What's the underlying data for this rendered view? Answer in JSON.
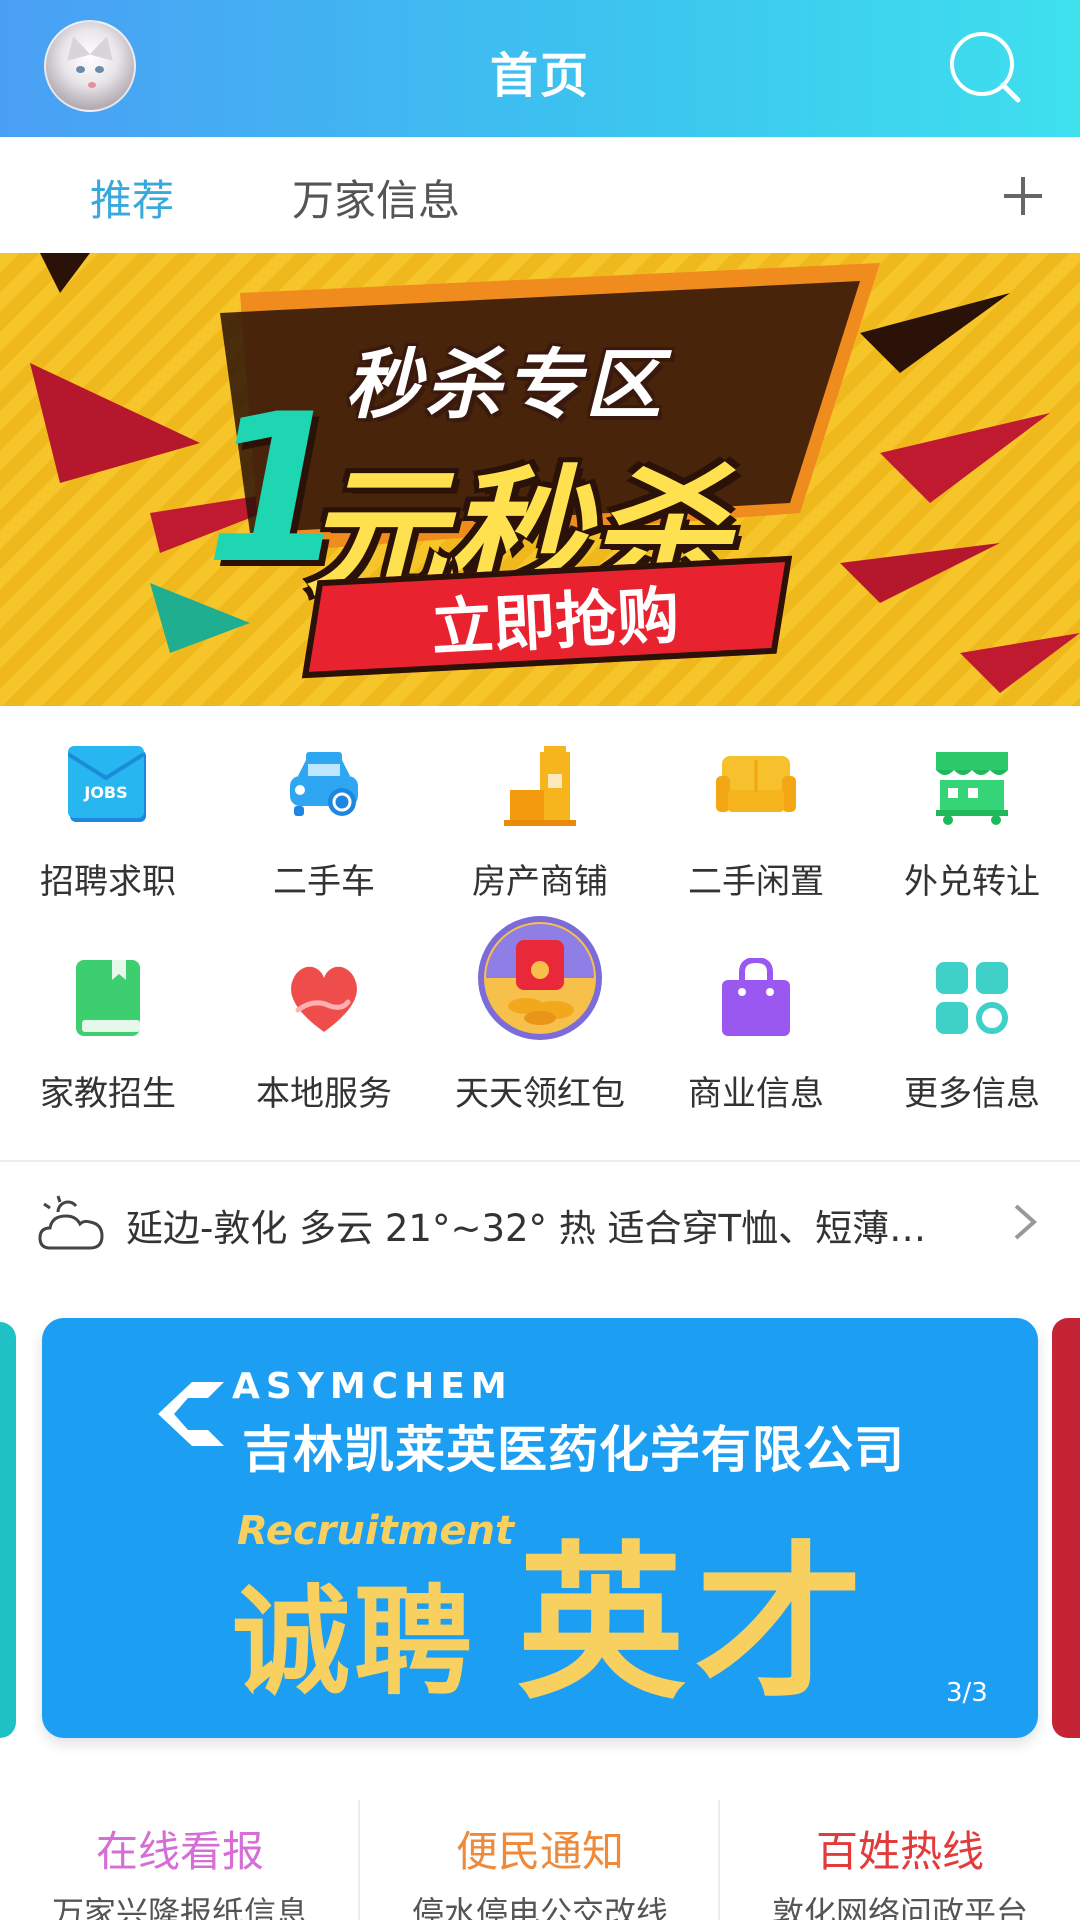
{
  "header": {
    "title": "首页"
  },
  "tabs": [
    {
      "label": "推荐",
      "active": true
    },
    {
      "label": "万家信息",
      "active": false
    }
  ],
  "banner": {
    "headline": "秒杀专区",
    "number": "1",
    "main": "元秒杀",
    "cta": "立即抢购",
    "dots": [
      {
        "active": false
      },
      {
        "active": true
      }
    ]
  },
  "categories": [
    {
      "label": "招聘求职",
      "icon": "jobs-envelope-icon"
    },
    {
      "label": "二手车",
      "icon": "car-icon"
    },
    {
      "label": "房产商铺",
      "icon": "building-icon"
    },
    {
      "label": "二手闲置",
      "icon": "sofa-icon"
    },
    {
      "label": "外兑转让",
      "icon": "storefront-icon"
    },
    {
      "label": "家教招生",
      "icon": "book-icon"
    },
    {
      "label": "本地服务",
      "icon": "heart-hand-icon"
    },
    {
      "label": "天天领红包",
      "icon": "red-envelope-icon"
    },
    {
      "label": "商业信息",
      "icon": "shopping-bag-icon"
    },
    {
      "label": "更多信息",
      "icon": "more-grid-icon"
    }
  ],
  "weather": {
    "text": "延边-敦化 多云 21°~32° 热 适合穿T恤、短薄…",
    "icon": "cloudy-sun-icon"
  },
  "ad": {
    "brand": "ASYMCHEM",
    "company": "吉林凯莱英医药化学有限公司",
    "recruit": "Recruitment",
    "slogan_a": "诚聘",
    "slogan_b": "英才",
    "page": "3/3"
  },
  "entries": [
    {
      "title": "在线看报",
      "subtitle": "万家兴隆报纸信息",
      "color": "#d56fd6"
    },
    {
      "title": "便民通知",
      "subtitle": "停水停电公交改线",
      "color": "#ef8a3a"
    },
    {
      "title": "百姓热线",
      "subtitle": "敦化网络问政平台",
      "color": "#e23b3b"
    }
  ],
  "colors": {
    "header_gradient_start": "#4a9ff5",
    "header_gradient_end": "#3ee0ee",
    "tab_active": "#39a9dd",
    "ad_background": "#1c9ef3"
  }
}
